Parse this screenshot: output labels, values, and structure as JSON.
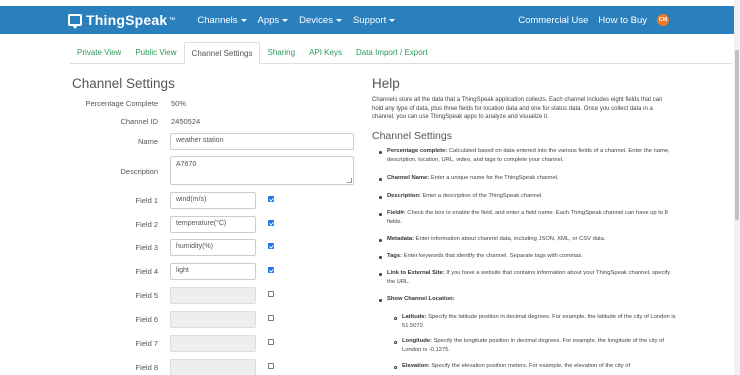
{
  "navbar": {
    "brand": "ThingSpeak",
    "brand_tm": "™",
    "menu": [
      "Channels",
      "Apps",
      "Devices",
      "Support"
    ],
    "commercial_use": "Commercial Use",
    "how_to_buy": "How to Buy",
    "avatar_initials": "CM",
    "accent_color": "#2a7fbd"
  },
  "tabs": [
    "Private View",
    "Public View",
    "Channel Settings",
    "Sharing",
    "API Keys",
    "Data Import / Export"
  ],
  "active_tab": "Channel Settings",
  "settings": {
    "title": "Channel Settings",
    "percentage_label": "Percentage Complete",
    "percentage_value": "50%",
    "channel_id_label": "Channel ID",
    "channel_id_value": "2450524",
    "name_label": "Name",
    "name_value": "weather station",
    "description_label": "Description",
    "description_value": "A7670",
    "fields": [
      {
        "label": "Field 1",
        "value": "wind(m/s)",
        "checked": true
      },
      {
        "label": "Field 2",
        "value": "temperature(°C)",
        "checked": true
      },
      {
        "label": "Field 3",
        "value": "humidity(%)",
        "checked": true
      },
      {
        "label": "Field 4",
        "value": "light",
        "checked": true
      },
      {
        "label": "Field 5",
        "value": "",
        "checked": false
      },
      {
        "label": "Field 6",
        "value": "",
        "checked": false
      },
      {
        "label": "Field 7",
        "value": "",
        "checked": false
      },
      {
        "label": "Field 8",
        "value": "",
        "checked": false
      }
    ]
  },
  "help": {
    "title": "Help",
    "intro": "Channels store all the data that a ThingSpeak application collects. Each channel includes eight fields that can hold any type of data, plus three fields for location data and one for status data. Once you collect data in a channel, you can use ThingSpeak apps to analyze and visualize it.",
    "subtitle": "Channel Settings",
    "items": [
      {
        "term": "Percentage complete:",
        "text": " Calculated based on data entered into the various fields of a channel. Enter the name, description, location, URL, video, and tags to complete your channel."
      },
      {
        "term": "Channel Name:",
        "text": " Enter a unique name for the ThingSpeak channel."
      },
      {
        "term": "Description:",
        "text": " Enter a description of the ThingSpeak channel."
      },
      {
        "term": "Field#:",
        "text": " Check the box to enable the field, and enter a field name. Each ThingSpeak channel can have up to 8 fields."
      },
      {
        "term": "Metadata:",
        "text": " Enter information about channel data, including JSON, XML, or CSV data."
      },
      {
        "term": "Tags:",
        "text": " Enter keywords that identify the channel. Separate tags with commas."
      },
      {
        "term": "Link to External Site:",
        "text": " If you have a website that contains information about your ThingSpeak channel, specify the URL."
      },
      {
        "term": "Show Channel Location:",
        "text": ""
      }
    ],
    "subitems": [
      {
        "term": "Latitude:",
        "text": " Specify the latitude position in decimal degrees. For example, the latitude of the city of London is 51.5072."
      },
      {
        "term": "Longitude:",
        "text": " Specify the longitude position in decimal degrees. For example, the longitude of the city of London is -0.1275."
      },
      {
        "term": "Elevation:",
        "text": " Specify the elevation position meters. For example, the elevation of the city of"
      }
    ]
  }
}
